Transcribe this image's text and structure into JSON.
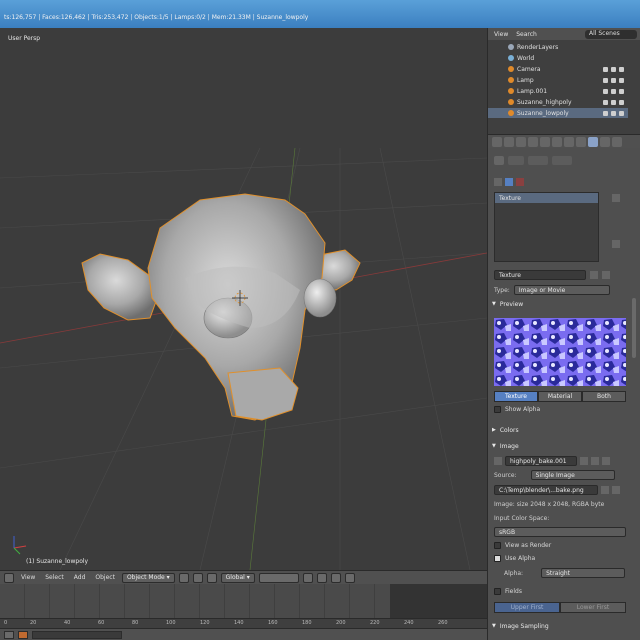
{
  "info_bar": {
    "stats": "ts:126,757 | Faces:126,462 | Tris:253,472 | Objects:1/5 | Lamps:0/2 | Mem:21.33M | Suzanne_lowpoly"
  },
  "viewport": {
    "label": "User Persp",
    "object_name": "(1) Suzanne_lowpoly"
  },
  "vp_header": {
    "menus": [
      "View",
      "Select",
      "Add",
      "Object"
    ],
    "mode": "Object Mode",
    "orientation": "Global"
  },
  "timeline": {
    "ruler": [
      "0",
      "20",
      "40",
      "60",
      "80",
      "100",
      "120",
      "140",
      "160",
      "180",
      "200",
      "220",
      "240",
      "260"
    ]
  },
  "outliner": {
    "menus": [
      "View",
      "Search"
    ],
    "scene_filter": "All Scenes",
    "rows": [
      {
        "label": "RenderLayers",
        "color": "#9aa7b8"
      },
      {
        "label": "World",
        "color": "#7ab0d6"
      },
      {
        "label": "Camera",
        "color": "#e08a2a"
      },
      {
        "label": "Lamp",
        "color": "#e08a2a"
      },
      {
        "label": "Lamp.001",
        "color": "#e08a2a"
      },
      {
        "label": "Suzanne_highpoly",
        "color": "#e08a2a"
      },
      {
        "label": "Suzanne_lowpoly",
        "color": "#e08a2a",
        "selected": true
      }
    ]
  },
  "props": {
    "slots": [
      {
        "label": "Texture",
        "active": true
      },
      {
        "label": ""
      },
      {
        "label": ""
      },
      {
        "label": ""
      },
      {
        "label": ""
      }
    ],
    "texture_name": "Texture",
    "type_label": "Type:",
    "type_value": "Image or Movie",
    "preview_label": "Preview",
    "preview_tabs": [
      "Texture",
      "Material",
      "Both"
    ],
    "show_alpha": "Show Alpha",
    "colors_label": "Colors",
    "image_label": "Image",
    "image_name": "highpoly_bake.001",
    "source_label": "Source:",
    "source_value": "Single Image",
    "filepath": "C:\\Temp\\blender\\...bake.png",
    "image_info": "Image: size 2048 x 2048, RGBA byte",
    "input_color_space": "Input Color Space:",
    "color_space_value": "sRGB",
    "view_as_render": "View as Render",
    "use_alpha": "Use Alpha",
    "alpha_label": "Alpha:",
    "alpha_value": "Straight",
    "fields": "Fields",
    "field_order": [
      "Upper First",
      "Lower First"
    ],
    "image_sampling": "Image Sampling"
  },
  "colors": {
    "accent": "#5680c2",
    "selection": "#e0902c",
    "title_bar": "#3b7fc0"
  }
}
